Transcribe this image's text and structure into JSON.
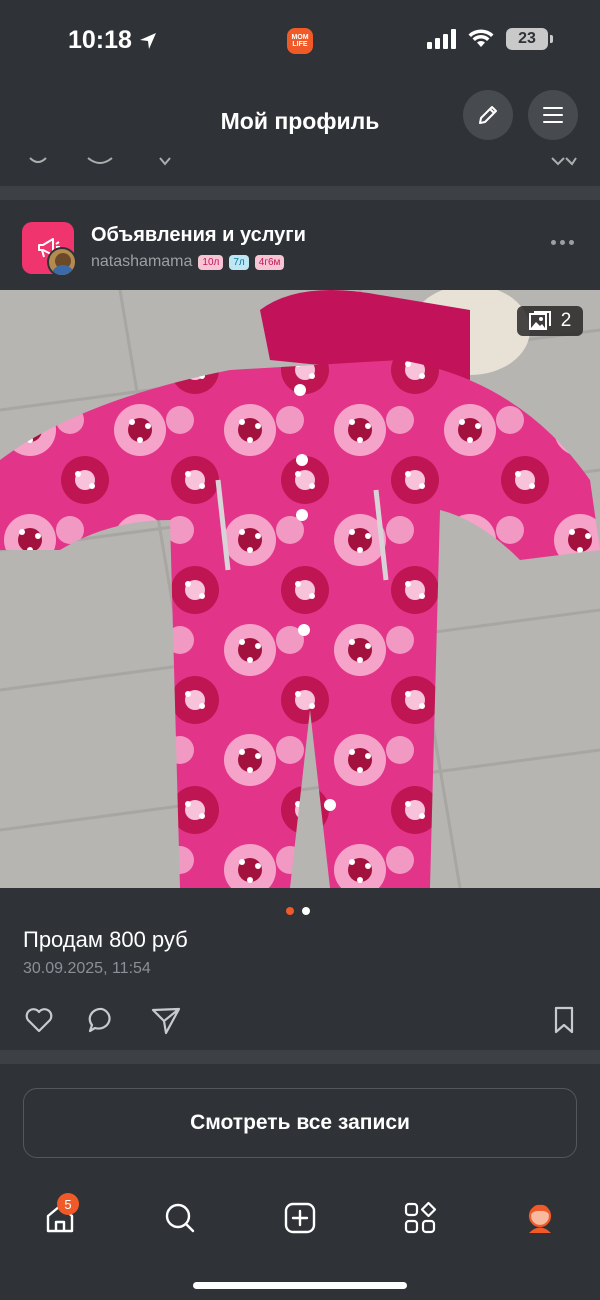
{
  "status_bar": {
    "time": "10:18",
    "app_logo_line1": "MOM",
    "app_logo_line2": "LIFE",
    "battery": "23"
  },
  "header": {
    "title": "Мой профиль"
  },
  "post": {
    "group_name": "Объявления и услуги",
    "username": "natashamama",
    "child_tags": [
      "10л",
      "7л",
      "4г6м"
    ],
    "photo_count": "2",
    "text": "Продам 800 руб",
    "date": "30.09.2025, 11:54",
    "carousel": {
      "active": 0,
      "total": 2
    }
  },
  "all_posts_button": "Смотреть все записи",
  "tabbar": {
    "notification_count": "5",
    "items": [
      "home-icon",
      "search-icon",
      "add-icon",
      "services-icon",
      "profile-icon"
    ]
  },
  "colors": {
    "background": "#2f3337",
    "accent": "#f05a28",
    "group_avatar": "#f0356e",
    "muted_text": "#8a9096"
  }
}
